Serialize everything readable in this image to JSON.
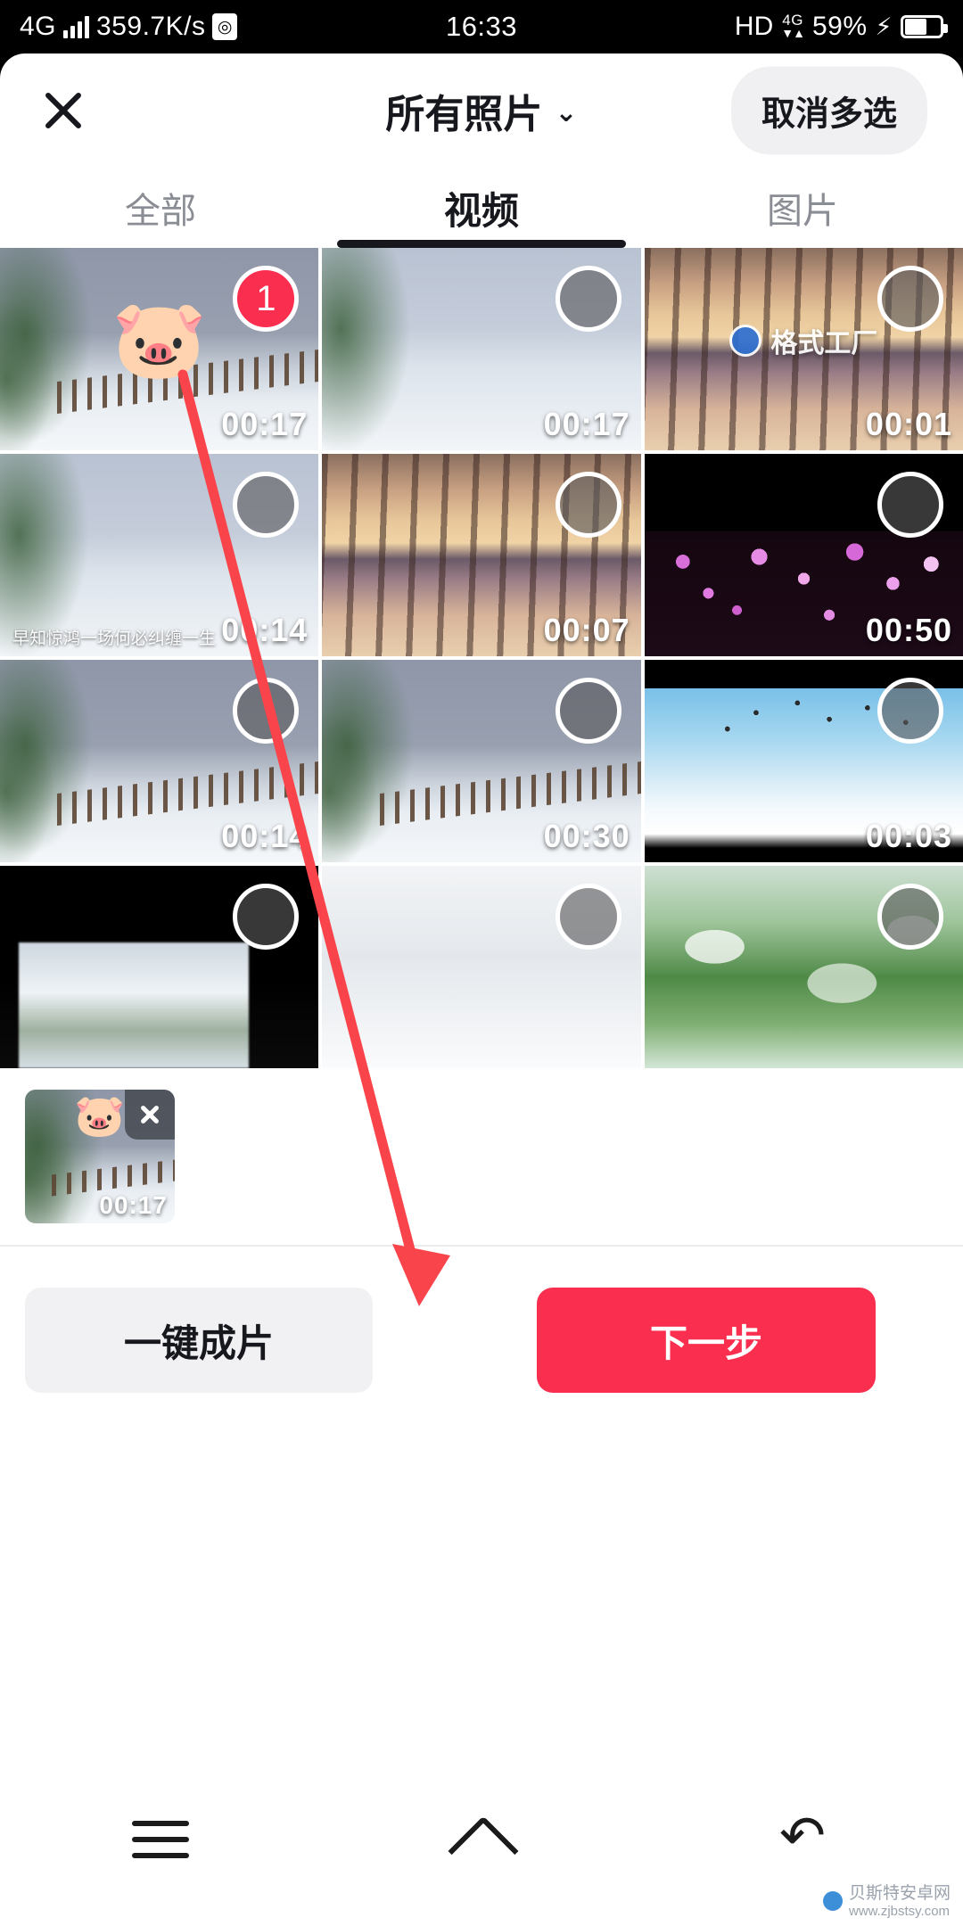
{
  "status_bar": {
    "network_type": "4G",
    "speed": "359.7K/s",
    "sim_icon": "sim-card-icon",
    "time": "16:33",
    "hd": "HD",
    "second_network": "4G",
    "battery_percent": "59%",
    "charging_icon": "lightning-bolt-icon"
  },
  "header": {
    "close_icon": "close-icon",
    "title": "所有照片",
    "chevron": "⌄",
    "multi_select_label": "取消多选"
  },
  "tabs": [
    {
      "label": "全部",
      "active": false
    },
    {
      "label": "视频",
      "active": true
    },
    {
      "label": "图片",
      "active": false
    }
  ],
  "grid": {
    "items": [
      {
        "duration": "00:17",
        "selected": true,
        "badge": "1",
        "art": "snowfence",
        "sticker": "🐷",
        "caption": "",
        "watermark": ""
      },
      {
        "duration": "00:17",
        "selected": false,
        "badge": "",
        "art": "snowfence2",
        "sticker": "",
        "caption": "",
        "watermark": ""
      },
      {
        "duration": "00:01",
        "selected": false,
        "badge": "",
        "art": "sunsettrees",
        "sticker": "",
        "caption": "",
        "watermark": "格式工厂"
      },
      {
        "duration": "00:14",
        "selected": false,
        "badge": "",
        "art": "snowfence2",
        "sticker": "",
        "caption": "早知惊鸿一场何必纠缠一生",
        "watermark": ""
      },
      {
        "duration": "00:07",
        "selected": false,
        "badge": "",
        "art": "sunsettrees",
        "sticker": "",
        "caption": "",
        "watermark": ""
      },
      {
        "duration": "00:50",
        "selected": false,
        "badge": "",
        "art": "blossoms",
        "sticker": "",
        "caption": "",
        "watermark": ""
      },
      {
        "duration": "00:14",
        "selected": false,
        "badge": "",
        "art": "snowfence",
        "sticker": "",
        "caption": "",
        "watermark": ""
      },
      {
        "duration": "00:30",
        "selected": false,
        "badge": "",
        "art": "snowfence",
        "sticker": "",
        "caption": "",
        "watermark": ""
      },
      {
        "duration": "00:03",
        "selected": false,
        "badge": "",
        "art": "birdsky",
        "sticker": "",
        "caption": "",
        "watermark": ""
      },
      {
        "duration": "",
        "selected": false,
        "badge": "",
        "art": "darkframe",
        "sticker": "",
        "caption": "",
        "watermark": ""
      },
      {
        "duration": "",
        "selected": false,
        "badge": "",
        "art": "cloudy",
        "sticker": "",
        "caption": "",
        "watermark": ""
      },
      {
        "duration": "",
        "selected": false,
        "badge": "",
        "art": "greenleaf",
        "sticker": "",
        "caption": "",
        "watermark": ""
      }
    ]
  },
  "tray": {
    "items": [
      {
        "duration": "00:17",
        "sticker": "🐷",
        "remove_icon": "close-icon"
      }
    ]
  },
  "actions": {
    "secondary_label": "一键成片",
    "primary_label": "下一步"
  },
  "nav_bar": {
    "menu_icon": "menu-icon",
    "home_icon": "home-icon",
    "back_icon": "back-icon"
  },
  "annotation": {
    "arrow_color": "#f8444a"
  },
  "page_watermark": {
    "text": "贝斯特安卓网",
    "url": "www.zjbstsy.com"
  },
  "colors": {
    "accent_red": "#fa2e4e",
    "text_primary": "#16181d",
    "text_muted": "#8a8d94",
    "chip_bg": "#f0f0f2"
  }
}
